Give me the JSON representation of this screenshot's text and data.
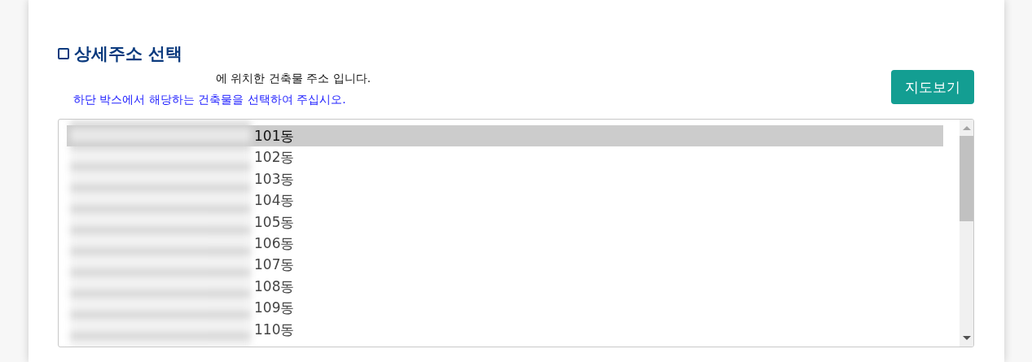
{
  "section": {
    "title": "상세주소 선택",
    "location_note": "에 위치한 건축물 주소 입니다.",
    "instruction": "하단 박스에서 해당하는 건축물을 선택하여 주십시오.",
    "map_button": "지도보기"
  },
  "address_list": [
    {
      "label": "101동",
      "selected": true
    },
    {
      "label": "102동",
      "selected": false
    },
    {
      "label": "103동",
      "selected": false
    },
    {
      "label": "104동",
      "selected": false
    },
    {
      "label": "105동",
      "selected": false
    },
    {
      "label": "106동",
      "selected": false
    },
    {
      "label": "107동",
      "selected": false
    },
    {
      "label": "108동",
      "selected": false
    },
    {
      "label": "109동",
      "selected": false
    },
    {
      "label": "110동",
      "selected": false
    }
  ]
}
